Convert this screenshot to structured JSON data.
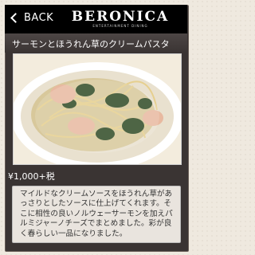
{
  "header": {
    "back_label": "BACK",
    "logo_name": "BERONICA",
    "logo_subtitle": "ENTERTAINMENT DINING"
  },
  "dish": {
    "title": "サーモンとほうれん草のクリームパスタ",
    "price": "¥1,000+税",
    "description": "マイルドなクリームソースをほうれん草があっさりとしたソースに仕上げてくれます。そこに相性の良いノルウェーサーモンを加えパルミジャーノチーズでまとめました。彩が良く春らしい一品になりました。"
  },
  "colors": {
    "header_bg": "#000000",
    "panel_bg": "#3a3433",
    "page_bg": "#efe9df"
  },
  "icons": {
    "back": "chevron-left-icon"
  }
}
